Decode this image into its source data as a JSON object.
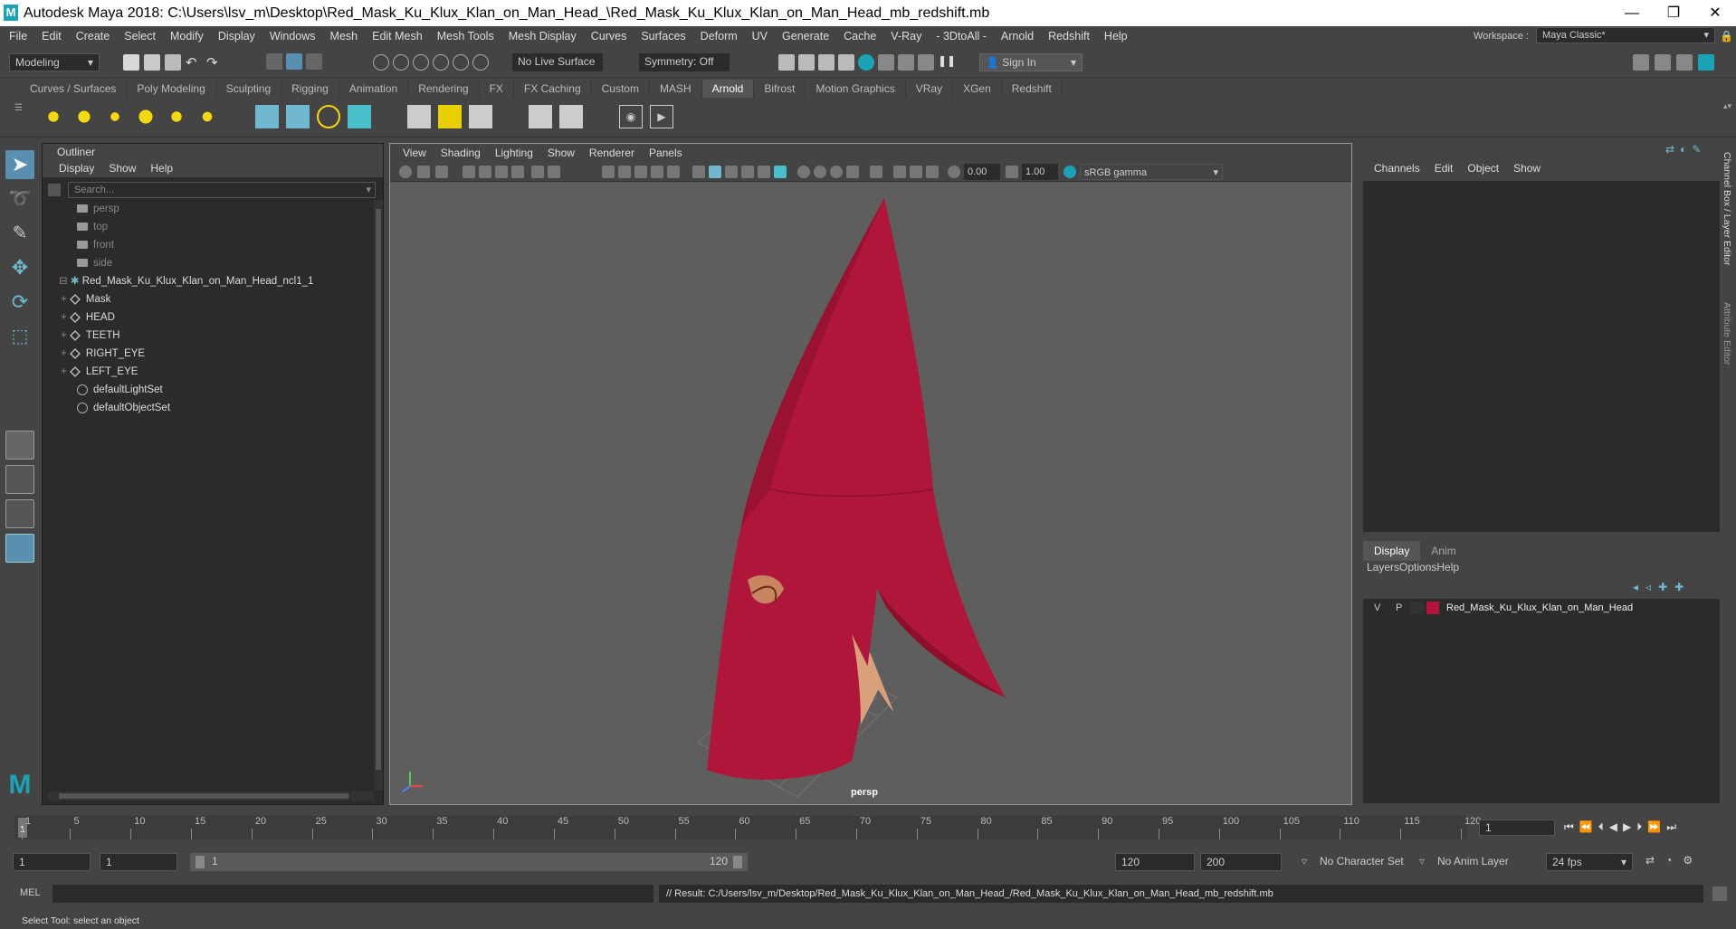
{
  "window": {
    "title": "Autodesk Maya 2018: C:\\Users\\lsv_m\\Desktop\\Red_Mask_Ku_Klux_Klan_on_Man_Head_\\Red_Mask_Ku_Klux_Klan_on_Man_Head_mb_redshift.mb",
    "logo": "M",
    "minimize": "—",
    "restore": "❐",
    "close": "✕"
  },
  "menubar": {
    "items": [
      "File",
      "Edit",
      "Create",
      "Select",
      "Modify",
      "Display",
      "Windows",
      "Mesh",
      "Edit Mesh",
      "Mesh Tools",
      "Mesh Display",
      "Curves",
      "Surfaces",
      "Deform",
      "UV",
      "Generate",
      "Cache",
      "V-Ray",
      "- 3DtoAll -",
      "Arnold",
      "Redshift",
      "Help"
    ],
    "workspace_label": "Workspace :",
    "workspace_value": "Maya Classic*"
  },
  "statusline": {
    "mode": "Modeling",
    "live_surface": "No Live Surface",
    "symmetry": "Symmetry: Off",
    "sign_in": "Sign In"
  },
  "shelf": {
    "tabs": [
      "Curves / Surfaces",
      "Poly Modeling",
      "Sculpting",
      "Rigging",
      "Animation",
      "Rendering",
      "FX",
      "FX Caching",
      "Custom",
      "MASH",
      "Arnold",
      "Bifrost",
      "Motion Graphics",
      "VRay",
      "XGen",
      "Redshift"
    ],
    "active_tab": "Arnold"
  },
  "outliner": {
    "title": "Outliner",
    "menu": [
      "Display",
      "Show",
      "Help"
    ],
    "search_placeholder": "Search...",
    "cameras": [
      "persp",
      "top",
      "front",
      "side"
    ],
    "group": "Red_Mask_Ku_Klux_Klan_on_Man_Head_ncl1_1",
    "children": [
      "Mask",
      "HEAD",
      "TEETH",
      "RIGHT_EYE",
      "LEFT_EYE"
    ],
    "sets": [
      "defaultLightSet",
      "defaultObjectSet"
    ]
  },
  "viewport": {
    "menu": [
      "View",
      "Shading",
      "Lighting",
      "Show",
      "Renderer",
      "Panels"
    ],
    "exposure": "0.00",
    "gamma": "1.00",
    "color_space": "sRGB gamma",
    "camera_label": "persp",
    "mask_color": "#b0163a"
  },
  "channelbox": {
    "menu": [
      "Channels",
      "Edit",
      "Object",
      "Show"
    ],
    "layer_tabs": [
      "Display",
      "Anim"
    ],
    "layer_menu": [
      "Layers",
      "Options",
      "Help"
    ],
    "layer": {
      "v": "V",
      "p": "P",
      "name": "Red_Mask_Ku_Klux_Klan_on_Man_Head",
      "color": "#b0163a"
    },
    "side_tabs": [
      "Channel Box / Layer Editor",
      "Attribute Editor"
    ]
  },
  "timeline": {
    "ticks": [
      "1",
      "5",
      "10",
      "15",
      "20",
      "25",
      "30",
      "35",
      "40",
      "45",
      "50",
      "55",
      "60",
      "65",
      "70",
      "75",
      "80",
      "85",
      "90",
      "95",
      "100",
      "105",
      "110",
      "115",
      "120"
    ],
    "current_frame": "1"
  },
  "range": {
    "start": "1",
    "playback_start": "1",
    "slider_start": "1",
    "slider_end": "120",
    "playback_end": "120",
    "end": "200",
    "character_set": "No Character Set",
    "anim_layer": "No Anim Layer",
    "fps": "24 fps"
  },
  "cmdline": {
    "lang": "MEL",
    "result": "// Result: C:/Users/lsv_m/Desktop/Red_Mask_Ku_Klux_Klan_on_Man_Head_/Red_Mask_Ku_Klux_Klan_on_Man_Head_mb_redshift.mb"
  },
  "helpline": {
    "text": "Select Tool: select an object"
  }
}
